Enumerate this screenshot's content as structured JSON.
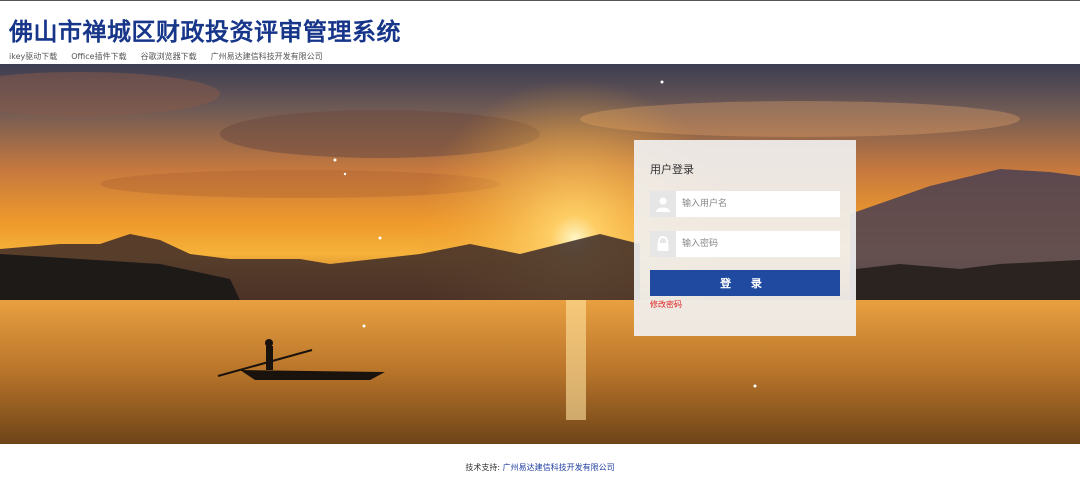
{
  "header": {
    "title": "佛山市禅城区财政投资评审管理系统",
    "links": [
      "ikey驱动下载",
      "Office插件下载",
      "谷歌浏览器下载",
      "广州易达建信科技开发有限公司"
    ]
  },
  "login": {
    "title": "用户登录",
    "username_placeholder": "输入用户名",
    "password_placeholder": "输入密码",
    "submit_label": "登 录",
    "change_password": "修改密码"
  },
  "footer": {
    "label": "技术支持:",
    "company": "广州易达建信科技开发有限公司"
  },
  "colors": {
    "brand": "#17368a",
    "button": "#1f4aa0",
    "warning": "#dd2222"
  }
}
